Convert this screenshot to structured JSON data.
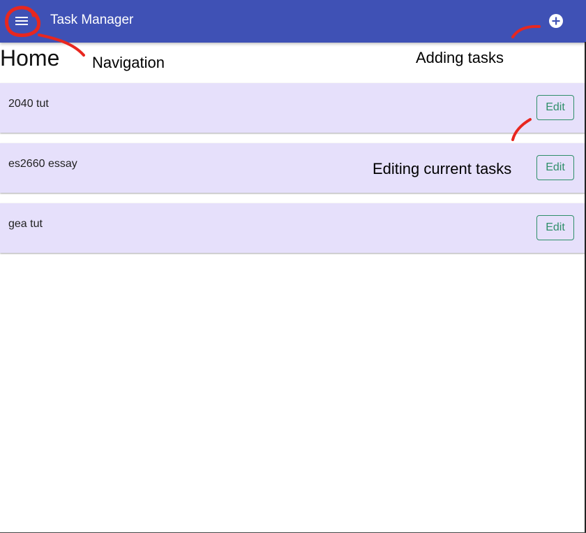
{
  "app_bar": {
    "title": "Task Manager",
    "menu_icon": "menu-icon",
    "add_icon": "add-circle-icon",
    "background_color": "#3f51b5"
  },
  "page": {
    "title": "Home"
  },
  "tasks": [
    {
      "name": "2040 tut",
      "action_label": "Edit"
    },
    {
      "name": "es2660 essay",
      "action_label": "Edit"
    },
    {
      "name": "gea tut",
      "action_label": "Edit"
    }
  ],
  "annotations": {
    "navigation": "Navigation",
    "adding_tasks": "Adding tasks",
    "editing_tasks": "Editing current tasks"
  },
  "colors": {
    "card_background": "#e6e0fb",
    "edit_button": "#2f8f6a",
    "annotation_ink": "#e8271f"
  }
}
